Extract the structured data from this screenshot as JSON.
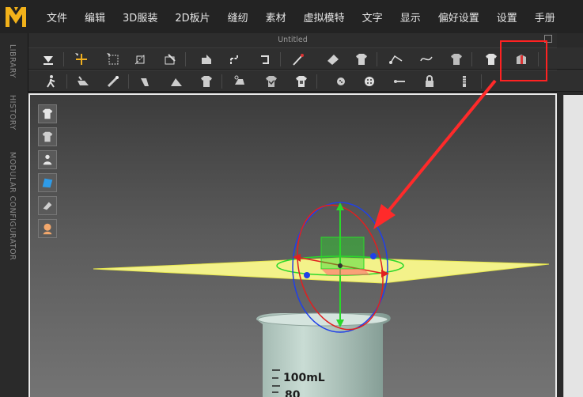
{
  "app": {
    "logo_alt": "MD logo",
    "window_title": "Untitled"
  },
  "menu": [
    {
      "label": "文件"
    },
    {
      "label": "编辑"
    },
    {
      "label": "3D服装"
    },
    {
      "label": "2D板片"
    },
    {
      "label": "缝纫"
    },
    {
      "label": "素材"
    },
    {
      "label": "虚拟模特"
    },
    {
      "label": "文字"
    },
    {
      "label": "显示"
    },
    {
      "label": "偏好设置"
    },
    {
      "label": "设置"
    },
    {
      "label": "手册"
    }
  ],
  "side_tabs": [
    {
      "label": "LIBRARY"
    },
    {
      "label": "HISTORY"
    },
    {
      "label": "MODULAR CONFIGURATOR"
    }
  ],
  "toolbar1_icons": [
    "move-down-icon",
    "transform-icon",
    "select-box-icon",
    "select-mesh-icon",
    "edit-pattern-icon",
    "fold-arrange-icon",
    "pin-icon",
    "tack-icon",
    "needle-icon",
    "brush-icon",
    "shirt-pin-icon",
    "segment-sewing-icon",
    "free-sewing-icon",
    "shirt-sew-icon",
    "avatar-shirt-icon",
    "highlighted-tool-icon"
  ],
  "toolbar2_icons": [
    "avatar-walk-icon",
    "steam-icon",
    "measure-icon",
    "fold-icon",
    "fold-angle-icon",
    "shirt-fabric-icon",
    "iron-icon",
    "shirt-check-icon",
    "shirt-print-icon",
    "button-icon",
    "button-round-icon",
    "zipper-line-icon",
    "lock-icon",
    "zipper-icon"
  ],
  "viewport_tools": [
    "shirt-display-icon",
    "shirt-mesh-icon",
    "avatar-icon",
    "texture-icon",
    "mesh-icon",
    "avatar-head-icon"
  ],
  "beaker": {
    "mark_100": "100mL",
    "mark_80": "80"
  },
  "colors": {
    "highlight": "#ff2222",
    "plane": "#f3f28a",
    "gizmo_x": "#e02020",
    "gizmo_y": "#2ad82a",
    "gizmo_z": "#2040e8"
  }
}
